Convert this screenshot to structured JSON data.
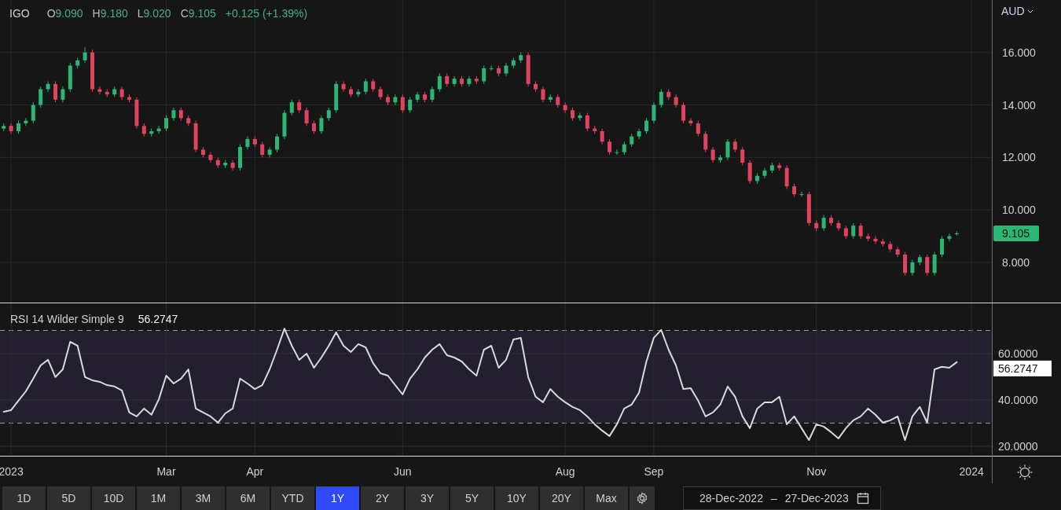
{
  "legend": {
    "symbol": "IGO",
    "fields": [
      {
        "label": "O",
        "value": "9.090"
      },
      {
        "label": "H",
        "value": "9.180"
      },
      {
        "label": "L",
        "value": "9.020"
      },
      {
        "label": "C",
        "value": "9.105"
      }
    ],
    "change": "+0.125 (+1.39%)"
  },
  "currency": "AUD",
  "price_chart": {
    "last_tag": "9.105",
    "chart_data": {
      "type": "candlestick",
      "grid": true,
      "ylim": [
        6.47,
        18.0
      ],
      "categories": [
        null,
        null,
        null,
        null,
        null,
        null,
        null,
        null,
        null,
        null,
        null,
        null,
        null,
        null,
        null,
        null,
        null,
        null,
        null,
        null,
        null,
        null,
        null,
        null,
        null,
        null,
        null,
        null,
        null,
        null,
        null,
        null,
        null,
        null,
        null,
        null,
        null,
        null,
        null,
        null,
        null,
        null,
        null,
        null,
        null,
        null,
        null,
        null,
        null,
        null,
        null,
        null,
        null,
        null,
        null,
        null,
        null,
        null,
        null,
        null,
        null,
        null,
        null,
        null,
        null,
        null,
        null,
        null,
        null,
        null,
        null,
        null,
        null,
        null,
        null,
        null,
        null,
        null,
        null,
        null,
        null,
        null,
        null,
        null,
        null,
        null,
        null,
        null,
        null,
        null,
        null,
        null,
        null,
        null,
        null,
        null,
        null,
        null,
        null,
        null,
        null,
        null,
        null,
        null,
        null,
        null,
        null,
        null,
        null,
        null,
        null,
        null,
        null,
        null,
        null,
        null,
        null,
        null,
        null,
        null,
        null,
        null,
        null,
        null,
        null,
        null,
        null,
        null,
        null,
        null
      ],
      "yticks": [
        {
          "value": 8,
          "label": "8.000"
        },
        {
          "value": 10,
          "label": "10.000"
        },
        {
          "value": 12,
          "label": "12.000"
        },
        {
          "value": 14,
          "label": "14.000"
        },
        {
          "value": 16,
          "label": "16.000"
        }
      ],
      "ohlc": [
        [
          13.1,
          13.3,
          13.0,
          13.2
        ],
        [
          13.2,
          13.3,
          12.9,
          13.0
        ],
        [
          13.0,
          13.4,
          12.9,
          13.3
        ],
        [
          13.3,
          13.5,
          13.2,
          13.4
        ],
        [
          13.4,
          14.1,
          13.3,
          14.0
        ],
        [
          14.0,
          14.7,
          13.9,
          14.6
        ],
        [
          14.6,
          14.9,
          14.5,
          14.8
        ],
        [
          14.8,
          14.9,
          14.1,
          14.2
        ],
        [
          14.2,
          14.7,
          14.1,
          14.6
        ],
        [
          14.6,
          15.6,
          14.5,
          15.5
        ],
        [
          15.5,
          15.8,
          15.4,
          15.7
        ],
        [
          15.7,
          16.2,
          15.6,
          16.0
        ],
        [
          16.0,
          16.1,
          14.5,
          14.6
        ],
        [
          14.6,
          14.7,
          14.4,
          14.5
        ],
        [
          14.5,
          14.6,
          14.3,
          14.4
        ],
        [
          14.4,
          14.7,
          14.3,
          14.6
        ],
        [
          14.6,
          14.7,
          14.2,
          14.3
        ],
        [
          14.3,
          14.4,
          14.1,
          14.2
        ],
        [
          14.2,
          14.3,
          13.1,
          13.2
        ],
        [
          13.2,
          13.3,
          12.8,
          12.9
        ],
        [
          12.9,
          13.1,
          12.8,
          13.0
        ],
        [
          13.0,
          13.2,
          12.9,
          13.1
        ],
        [
          13.1,
          13.6,
          13.0,
          13.5
        ],
        [
          13.5,
          13.9,
          13.4,
          13.8
        ],
        [
          13.8,
          13.9,
          13.4,
          13.5
        ],
        [
          13.5,
          13.6,
          13.2,
          13.3
        ],
        [
          13.3,
          13.4,
          12.2,
          12.3
        ],
        [
          12.3,
          12.4,
          12.0,
          12.1
        ],
        [
          12.1,
          12.2,
          11.8,
          11.9
        ],
        [
          11.9,
          12.0,
          11.6,
          11.7
        ],
        [
          11.7,
          11.9,
          11.6,
          11.8
        ],
        [
          11.8,
          11.9,
          11.5,
          11.6
        ],
        [
          11.6,
          12.5,
          11.5,
          12.4
        ],
        [
          12.4,
          12.8,
          12.3,
          12.7
        ],
        [
          12.7,
          12.8,
          12.4,
          12.5
        ],
        [
          12.5,
          12.6,
          12.0,
          12.1
        ],
        [
          12.1,
          12.4,
          12.0,
          12.3
        ],
        [
          12.3,
          12.9,
          12.2,
          12.8
        ],
        [
          12.8,
          13.8,
          12.7,
          13.7
        ],
        [
          13.7,
          14.2,
          13.6,
          14.1
        ],
        [
          14.1,
          14.2,
          13.7,
          13.8
        ],
        [
          13.8,
          13.9,
          13.2,
          13.3
        ],
        [
          13.3,
          13.4,
          12.9,
          13.0
        ],
        [
          13.0,
          13.6,
          12.9,
          13.5
        ],
        [
          13.5,
          13.9,
          13.4,
          13.8
        ],
        [
          13.8,
          14.9,
          13.7,
          14.8
        ],
        [
          14.8,
          14.9,
          14.5,
          14.6
        ],
        [
          14.6,
          14.7,
          14.3,
          14.4
        ],
        [
          14.4,
          14.6,
          14.3,
          14.5
        ],
        [
          14.5,
          15.0,
          14.4,
          14.9
        ],
        [
          14.9,
          15.0,
          14.5,
          14.6
        ],
        [
          14.6,
          14.7,
          14.2,
          14.3
        ],
        [
          14.3,
          14.4,
          14.0,
          14.1
        ],
        [
          14.1,
          14.4,
          14.0,
          14.3
        ],
        [
          14.3,
          14.4,
          13.7,
          13.8
        ],
        [
          13.8,
          14.3,
          13.7,
          14.2
        ],
        [
          14.2,
          14.5,
          14.1,
          14.4
        ],
        [
          14.4,
          14.5,
          14.1,
          14.2
        ],
        [
          14.2,
          14.7,
          14.1,
          14.6
        ],
        [
          14.6,
          15.2,
          14.5,
          15.1
        ],
        [
          15.1,
          15.2,
          14.7,
          14.8
        ],
        [
          14.8,
          15.1,
          14.7,
          15.0
        ],
        [
          15.0,
          15.1,
          14.7,
          14.8
        ],
        [
          14.8,
          15.1,
          14.7,
          15.0
        ],
        [
          15.0,
          15.1,
          14.8,
          14.9
        ],
        [
          14.9,
          15.5,
          14.8,
          15.4
        ],
        [
          15.4,
          15.5,
          15.3,
          15.4
        ],
        [
          15.4,
          15.5,
          15.1,
          15.2
        ],
        [
          15.2,
          15.6,
          15.1,
          15.5
        ],
        [
          15.5,
          15.8,
          15.4,
          15.7
        ],
        [
          15.7,
          16.0,
          15.6,
          15.9
        ],
        [
          15.9,
          16.0,
          14.7,
          14.8
        ],
        [
          14.8,
          14.9,
          14.5,
          14.6
        ],
        [
          14.6,
          14.7,
          14.1,
          14.2
        ],
        [
          14.2,
          14.4,
          14.1,
          14.3
        ],
        [
          14.3,
          14.4,
          13.9,
          14.0
        ],
        [
          14.0,
          14.1,
          13.7,
          13.8
        ],
        [
          13.8,
          13.9,
          13.4,
          13.5
        ],
        [
          13.5,
          13.7,
          13.4,
          13.6
        ],
        [
          13.6,
          13.7,
          13.0,
          13.1
        ],
        [
          13.1,
          13.2,
          12.9,
          13.0
        ],
        [
          13.0,
          13.1,
          12.5,
          12.6
        ],
        [
          12.6,
          12.7,
          12.1,
          12.2
        ],
        [
          12.2,
          12.3,
          12.1,
          12.2
        ],
        [
          12.2,
          12.6,
          12.1,
          12.5
        ],
        [
          12.5,
          12.9,
          12.4,
          12.8
        ],
        [
          12.8,
          13.1,
          12.7,
          13.0
        ],
        [
          13.0,
          13.5,
          12.9,
          13.4
        ],
        [
          13.4,
          14.1,
          13.3,
          14.0
        ],
        [
          14.0,
          14.6,
          13.9,
          14.5
        ],
        [
          14.5,
          14.6,
          14.2,
          14.3
        ],
        [
          14.3,
          14.4,
          13.9,
          14.0
        ],
        [
          14.0,
          14.1,
          13.3,
          13.4
        ],
        [
          13.4,
          13.5,
          13.2,
          13.3
        ],
        [
          13.3,
          13.4,
          12.8,
          12.9
        ],
        [
          12.9,
          13.0,
          12.2,
          12.3
        ],
        [
          12.3,
          12.4,
          11.8,
          11.9
        ],
        [
          11.9,
          12.1,
          11.8,
          12.0
        ],
        [
          12.0,
          12.7,
          11.9,
          12.6
        ],
        [
          12.6,
          12.7,
          12.2,
          12.3
        ],
        [
          12.3,
          12.4,
          11.7,
          11.8
        ],
        [
          11.8,
          11.9,
          11.0,
          11.1
        ],
        [
          11.1,
          11.4,
          11.0,
          11.3
        ],
        [
          11.3,
          11.6,
          11.2,
          11.5
        ],
        [
          11.5,
          11.8,
          11.4,
          11.7
        ],
        [
          11.7,
          11.8,
          11.5,
          11.6
        ],
        [
          11.6,
          11.7,
          10.8,
          10.9
        ],
        [
          10.9,
          11.0,
          10.5,
          10.6
        ],
        [
          10.6,
          10.7,
          10.5,
          10.6
        ],
        [
          10.6,
          10.7,
          9.4,
          9.5
        ],
        [
          9.5,
          9.6,
          9.2,
          9.3
        ],
        [
          9.3,
          9.8,
          9.2,
          9.7
        ],
        [
          9.7,
          9.8,
          9.4,
          9.5
        ],
        [
          9.5,
          9.6,
          9.2,
          9.3
        ],
        [
          9.3,
          9.4,
          8.9,
          9.0
        ],
        [
          9.0,
          9.5,
          8.9,
          9.4
        ],
        [
          9.4,
          9.5,
          8.9,
          9.0
        ],
        [
          9.0,
          9.1,
          8.8,
          8.9
        ],
        [
          8.9,
          9.0,
          8.7,
          8.8
        ],
        [
          8.8,
          8.9,
          8.6,
          8.7
        ],
        [
          8.7,
          8.8,
          8.4,
          8.5
        ],
        [
          8.5,
          8.6,
          8.2,
          8.3
        ],
        [
          8.3,
          8.4,
          7.5,
          7.6
        ],
        [
          7.6,
          8.1,
          7.5,
          8.0
        ],
        [
          8.0,
          8.3,
          7.9,
          8.2
        ],
        [
          8.2,
          8.3,
          7.5,
          7.6
        ],
        [
          7.6,
          8.4,
          7.5,
          8.3
        ],
        [
          8.3,
          9.0,
          8.2,
          8.9
        ],
        [
          8.9,
          9.1,
          8.8,
          9.0
        ],
        [
          9.09,
          9.18,
          9.02,
          9.105
        ]
      ]
    }
  },
  "rsi": {
    "value": "56.2747",
    "last_tag": "56.2747",
    "chart_data": {
      "type": "line",
      "grid": true,
      "ylim": [
        15.9,
        81.7
      ],
      "categories": [
        null,
        "2023",
        null,
        null,
        null,
        null,
        null,
        null,
        null,
        null,
        null,
        null,
        null,
        null,
        null,
        null,
        null,
        null,
        null,
        null,
        null,
        null,
        "Mar",
        null,
        null,
        null,
        null,
        null,
        null,
        null,
        null,
        null,
        null,
        null,
        "Apr",
        null,
        null,
        null,
        null,
        null,
        null,
        null,
        null,
        null,
        null,
        null,
        null,
        null,
        null,
        null,
        null,
        null,
        null,
        null,
        "Jun",
        null,
        null,
        null,
        null,
        null,
        null,
        null,
        null,
        null,
        null,
        null,
        null,
        null,
        null,
        null,
        null,
        null,
        null,
        null,
        null,
        null,
        "Aug",
        null,
        null,
        null,
        null,
        null,
        null,
        null,
        null,
        null,
        null,
        null,
        "Sep",
        null,
        null,
        null,
        null,
        null,
        null,
        null,
        null,
        null,
        null,
        null,
        null,
        null,
        null,
        null,
        null,
        null,
        null,
        null,
        null,
        null,
        "Nov",
        null,
        null,
        null,
        null,
        null,
        null,
        null,
        null,
        null,
        null,
        null,
        null,
        null,
        null,
        null,
        null,
        null,
        null,
        null,
        null,
        "2024"
      ],
      "yticks": [
        {
          "value": 20,
          "label": "20.0000"
        },
        {
          "value": 40,
          "label": "40.0000"
        },
        {
          "value": 60,
          "label": "60.0000"
        }
      ],
      "ref_lines": [
        {
          "axis": "y",
          "value": 70
        },
        {
          "axis": "y",
          "value": 30
        }
      ],
      "bands": [
        {
          "axis": "y",
          "from": 30,
          "to": 70
        }
      ],
      "series": [
        {
          "name": "RSI 14 Wilder Simple 9",
          "color": "#d9d9d9",
          "values": [
            34.9,
            35.6,
            39.7,
            43.7,
            49.2,
            54.9,
            57.3,
            49.9,
            53.2,
            65.1,
            63.4,
            49.9,
            48.5,
            47.8,
            46.4,
            45.8,
            44.1,
            34.6,
            32.9,
            36.3,
            33.6,
            40.3,
            50.5,
            47.1,
            49.2,
            53.2,
            36.3,
            34.6,
            32.9,
            30.2,
            34.2,
            36.3,
            49.2,
            47.1,
            44.7,
            46.4,
            53.2,
            61.7,
            70.8,
            63.4,
            57.3,
            60.0,
            53.9,
            58.3,
            63.4,
            69.2,
            63.4,
            60.7,
            64.1,
            62.7,
            55.9,
            51.5,
            50.5,
            46.4,
            42.4,
            49.2,
            53.2,
            58.3,
            61.7,
            64.1,
            59.3,
            58.3,
            56.6,
            53.2,
            50.5,
            61.7,
            63.4,
            53.9,
            57.3,
            66.1,
            66.8,
            49.9,
            41.4,
            39.0,
            44.7,
            41.4,
            39.0,
            37.0,
            35.6,
            32.9,
            29.5,
            26.8,
            24.4,
            29.5,
            36.3,
            38.0,
            43.1,
            56.6,
            66.8,
            70.2,
            61.7,
            54.9,
            44.7,
            45.1,
            39.7,
            32.9,
            34.6,
            38.0,
            45.8,
            41.4,
            32.9,
            27.8,
            36.3,
            39.0,
            39.0,
            41.4,
            29.5,
            32.9,
            27.8,
            22.7,
            29.5,
            28.5,
            26.1,
            23.4,
            27.8,
            31.2,
            32.9,
            36.3,
            33.6,
            30.2,
            31.2,
            32.9,
            22.7,
            32.9,
            37.0,
            30.2,
            53.2,
            54.3,
            53.9,
            56.3,
            null,
            null
          ]
        }
      ]
    }
  },
  "ranges": [
    {
      "label": "1D",
      "selected": false
    },
    {
      "label": "5D",
      "selected": false
    },
    {
      "label": "10D",
      "selected": false
    },
    {
      "label": "1M",
      "selected": false
    },
    {
      "label": "3M",
      "selected": false
    },
    {
      "label": "6M",
      "selected": false
    },
    {
      "label": "YTD",
      "selected": false
    },
    {
      "label": "1Y",
      "selected": true
    },
    {
      "label": "2Y",
      "selected": false
    },
    {
      "label": "3Y",
      "selected": false
    },
    {
      "label": "5Y",
      "selected": false
    },
    {
      "label": "10Y",
      "selected": false
    },
    {
      "label": "20Y",
      "selected": false
    },
    {
      "label": "Max",
      "selected": false
    }
  ],
  "date_range": {
    "from": "28-Dec-2022",
    "separator": "–",
    "to": "27-Dec-2023"
  }
}
